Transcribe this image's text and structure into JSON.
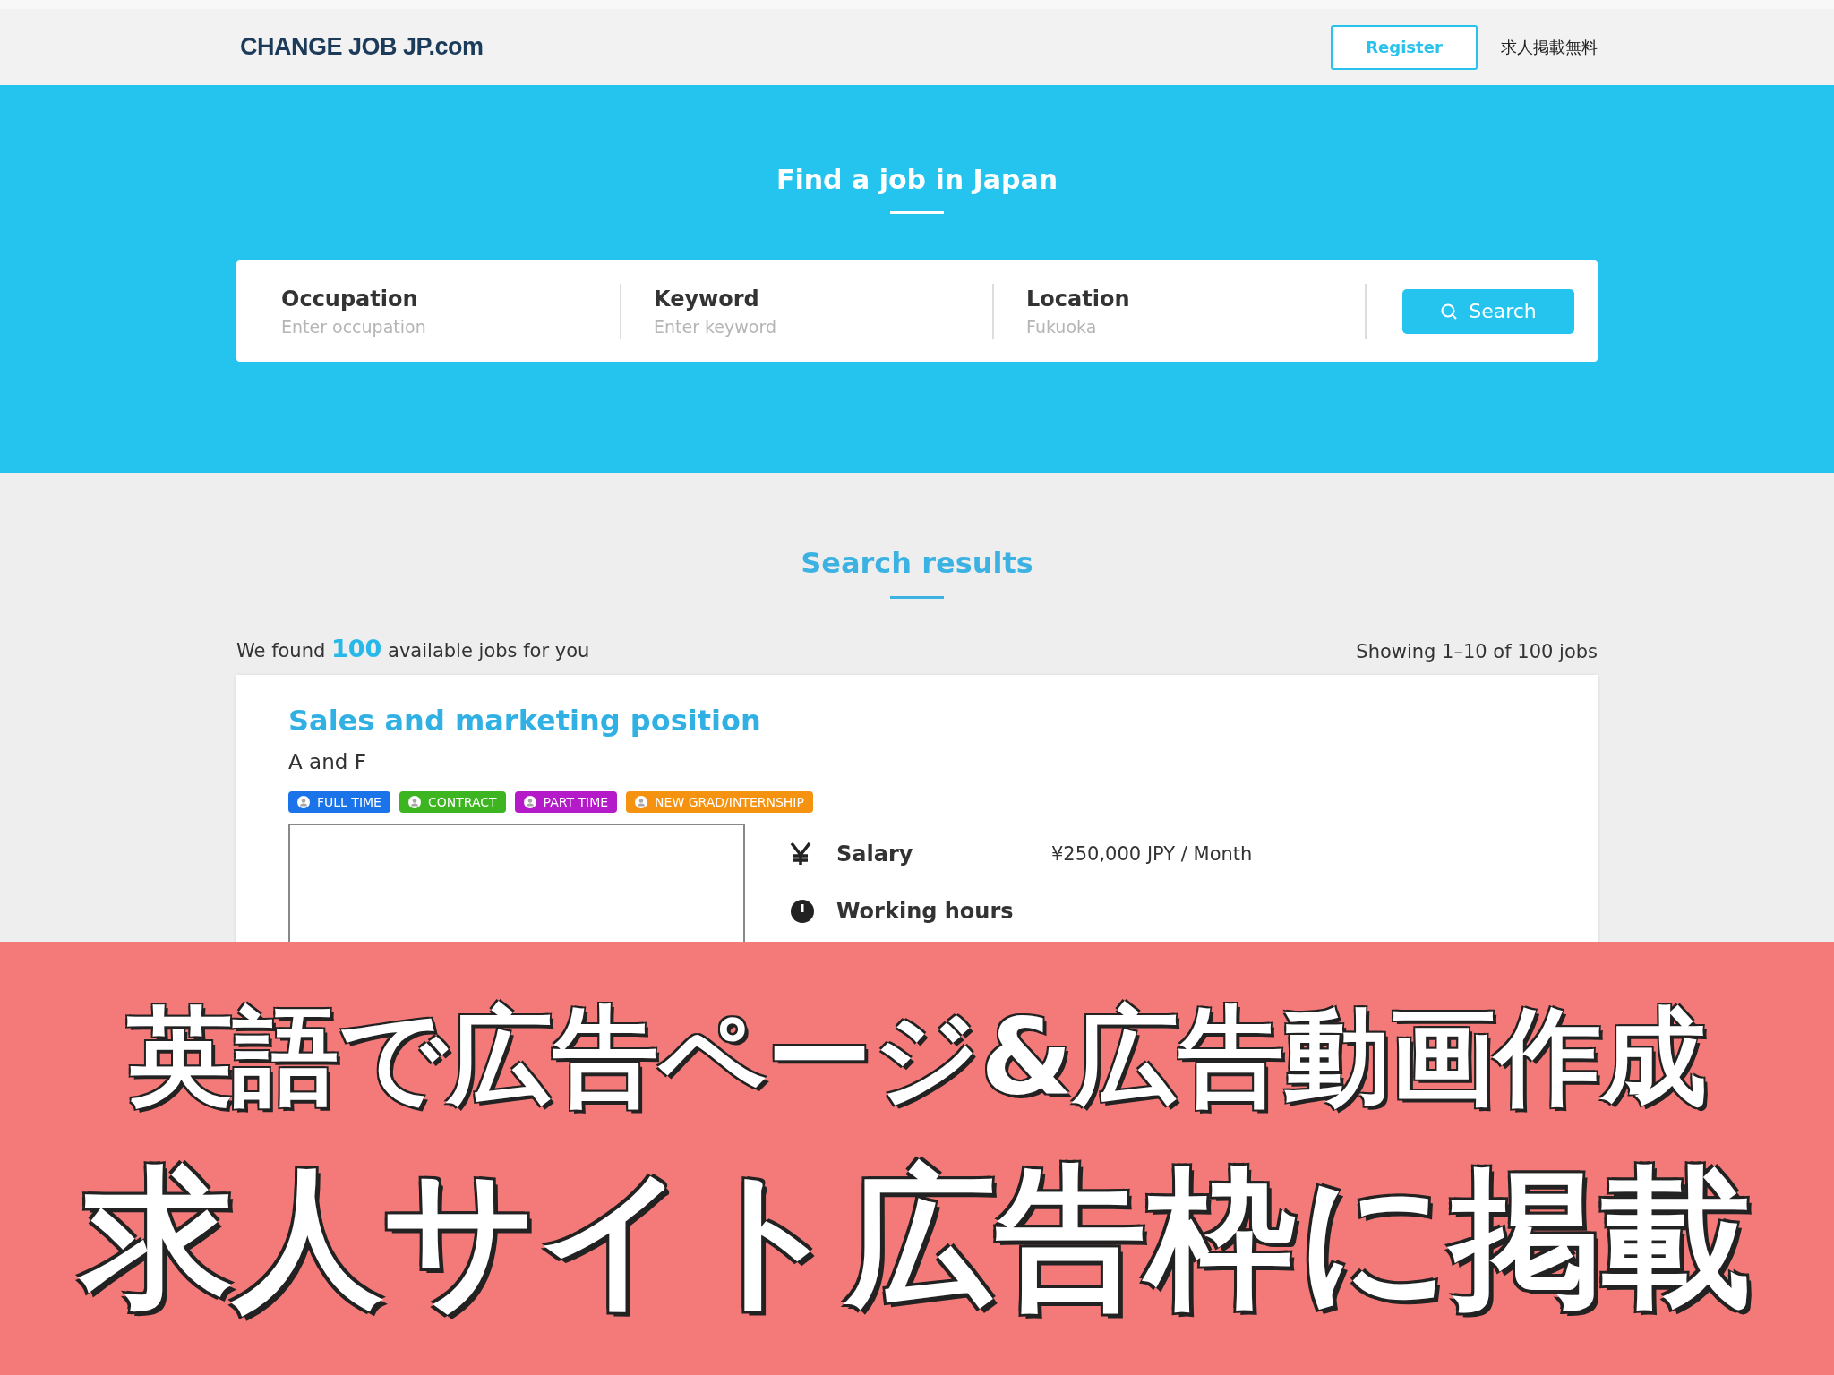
{
  "header": {
    "logo": "CHANGE JOB JP.com",
    "register_button": "Register",
    "post_link": "求人掲載無料"
  },
  "hero": {
    "title": "Find a job in Japan",
    "fields": [
      {
        "label": "Occupation",
        "placeholder": "Enter occupation"
      },
      {
        "label": "Keyword",
        "placeholder": "Enter keyword"
      },
      {
        "label": "Location",
        "placeholder": "Fukuoka"
      }
    ],
    "search_button": "Search"
  },
  "results": {
    "title": "Search results",
    "found_prefix": "We found",
    "found_count": "100",
    "found_suffix": "available jobs for you",
    "showing": "Showing 1–10 of 100 jobs",
    "job": {
      "title": "Sales and marketing position",
      "company": "A and F",
      "tags": [
        {
          "label": "FULL TIME",
          "color": "#1a73e8"
        },
        {
          "label": "CONTRACT",
          "color": "#3cb521"
        },
        {
          "label": "PART TIME",
          "color": "#b41ac8"
        },
        {
          "label": "NEW GRAD/INTERNSHIP",
          "color": "#f5920f"
        }
      ],
      "details": [
        {
          "kind": "salary",
          "label": "Salary",
          "value": "¥250,000 JPY / Month"
        },
        {
          "kind": "hours",
          "label": "Working hours"
        }
      ]
    }
  },
  "banner": {
    "line_1": "英語で広告ページ&広告動画作成",
    "line_2": "求人サイト広告枠に掲載"
  }
}
